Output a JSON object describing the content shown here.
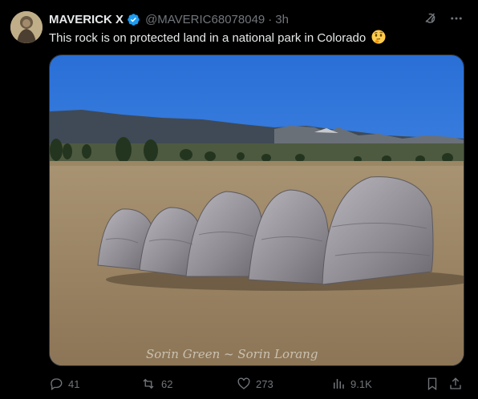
{
  "post": {
    "author_name": "MAVERICK X",
    "handle": "@MAVERIC68078049",
    "separator": "·",
    "time": "3h",
    "text": "This rock is on protected land in a national park in Colorado",
    "emoji": "thinking-face-emoji",
    "image_watermark": "Sorin Green ~ Sorin Lorang"
  },
  "metrics": {
    "replies": "41",
    "reposts": "62",
    "likes": "273",
    "views": "9.1K"
  },
  "icons": {
    "verified": "verified-badge-icon",
    "grok": "grok-icon",
    "more": "more-icon",
    "reply": "reply-icon",
    "repost": "repost-icon",
    "like": "heart-icon",
    "views": "views-icon",
    "bookmark": "bookmark-icon",
    "share": "share-icon"
  },
  "colors": {
    "background": "#000000",
    "text": "#e7e9ea",
    "muted": "#71767b",
    "verified": "#1d9bf0"
  }
}
